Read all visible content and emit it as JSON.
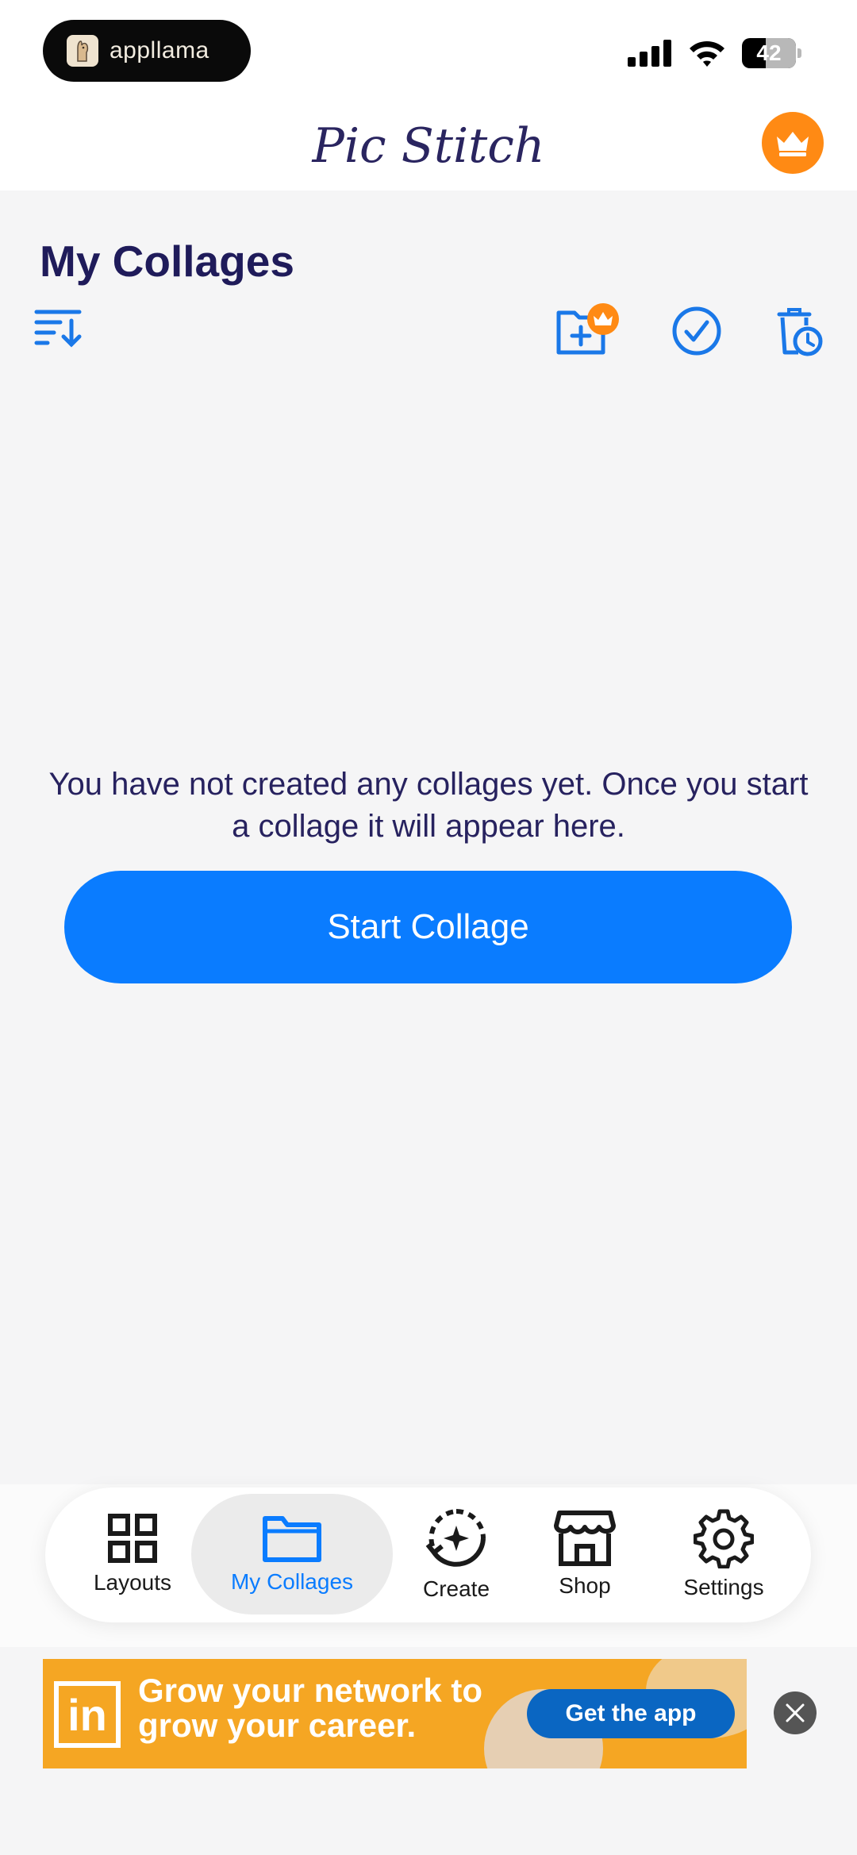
{
  "status_bar": {
    "app_badge_label": "appllama",
    "battery_level": "42"
  },
  "header": {
    "app_title": "Pic Stitch"
  },
  "main": {
    "section_title": "My Collages",
    "empty_message": "You have not created any collages yet. Once you start a collage it will appear here.",
    "start_button_label": "Start Collage"
  },
  "tabbar": {
    "tabs": [
      {
        "label": "Layouts",
        "icon": "grid-icon",
        "active": false
      },
      {
        "label": "My Collages",
        "icon": "folder-icon",
        "active": true
      },
      {
        "label": "Create",
        "icon": "create-sparkle-icon",
        "active": false
      },
      {
        "label": "Shop",
        "icon": "storefront-icon",
        "active": false
      },
      {
        "label": "Settings",
        "icon": "gear-icon",
        "active": false
      }
    ]
  },
  "ad": {
    "logo_text": "in",
    "headline": "Grow your network to grow your career.",
    "cta_label": "Get the app"
  },
  "colors": {
    "accent_blue": "#0a7cff",
    "premium_orange": "#ff8a14",
    "title_navy": "#1f1b5a",
    "ad_orange": "#f5a623",
    "ad_cta_blue": "#0a66c2"
  }
}
